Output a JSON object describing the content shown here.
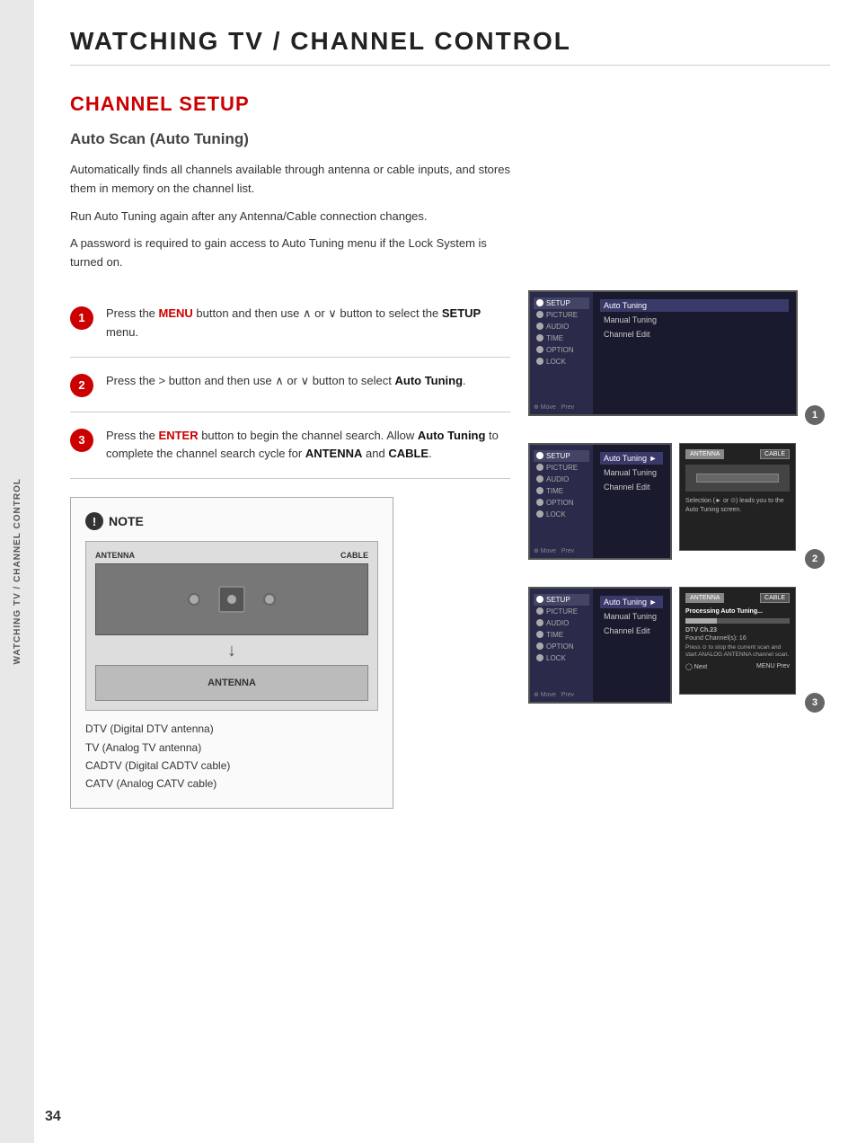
{
  "page": {
    "title": "WATCHING TV / CHANNEL CONTROL",
    "section_title": "CHANNEL SETUP",
    "subsection_title": "Auto Scan (Auto Tuning)",
    "sidebar_text": "WATCHING TV / CHANNEL CONTROL",
    "page_number": "34"
  },
  "intro": {
    "para1": "Automatically finds all channels available through antenna or cable inputs, and stores them in memory on the channel list.",
    "para2": "Run Auto Tuning again after any Antenna/Cable connection changes.",
    "para3": "A password is required to gain access to Auto Tuning menu if the Lock System is turned on."
  },
  "steps": [
    {
      "number": "1",
      "text_parts": [
        "Press the ",
        "MENU",
        " button and then use ∧ or ∨ button to select the ",
        "SETUP",
        " menu."
      ]
    },
    {
      "number": "2",
      "text_parts": [
        "Press the > button and then use ∧ or ∨ button to select ",
        "Auto Tuning",
        "."
      ]
    },
    {
      "number": "3",
      "text_parts": [
        "Press the ",
        "ENTER",
        " button to begin the channel search. Allow ",
        "Auto Tuning",
        " to complete the channel search cycle for ",
        "ANTENNA",
        " and ",
        "CABLE",
        "."
      ]
    }
  ],
  "note": {
    "title": "NOTE",
    "items": [
      "DTV (Digital DTV antenna)",
      "TV (Analog TV antenna)",
      "CADTV (Digital CADTV cable)",
      "CATV (Analog CATV cable)"
    ],
    "antenna_label": "ANTENNA",
    "cable_label": "CABLE"
  },
  "screens": [
    {
      "badge": "1",
      "sidebar_items": [
        "SETUP",
        "PICTURE",
        "AUDIO",
        "TIME",
        "OPTION",
        "LOCK"
      ],
      "active_sidebar": "SETUP",
      "menu_items": [
        "Auto Tuning",
        "Manual Tuning",
        "Channel Edit"
      ],
      "active_menu": "Auto Tuning",
      "footer": "Move  Prev"
    },
    {
      "badge": "2",
      "sidebar_items": [
        "SETUP",
        "PICTURE",
        "AUDIO",
        "TIME",
        "OPTION",
        "LOCK"
      ],
      "active_sidebar": "SETUP",
      "menu_items": [
        "Auto Tuning",
        "Manual Tuning",
        "Channel Edit"
      ],
      "active_menu": "Auto Tuning",
      "footer": "Move  Prev",
      "sub_text": "Selection (► or ⊙) leads you to the Auto Tuning screen.",
      "ext_labels": [
        "ANTENNA",
        "CABLE"
      ]
    },
    {
      "badge": "3",
      "sidebar_items": [
        "SETUP",
        "PICTURE",
        "AUDIO",
        "TIME",
        "OPTION",
        "LOCK"
      ],
      "active_sidebar": "SETUP",
      "menu_items": [
        "Auto Tuning",
        "Manual Tuning",
        "Channel Edit"
      ],
      "active_menu": "Auto Tuning",
      "footer": "Move  Prev",
      "sub_text": "Processing Auto Tuning...",
      "dtv_text": "DTV Ch.23",
      "found_text": "Found Channel(s): 16",
      "stop_text": "Press ⊙ to stop the current scan and start ANALOG ANTENNA channel scan.",
      "ext_labels": [
        "ANTENNA",
        "CABLE"
      ],
      "bottom_nav": "◯ Next  MENU Prev"
    }
  ]
}
